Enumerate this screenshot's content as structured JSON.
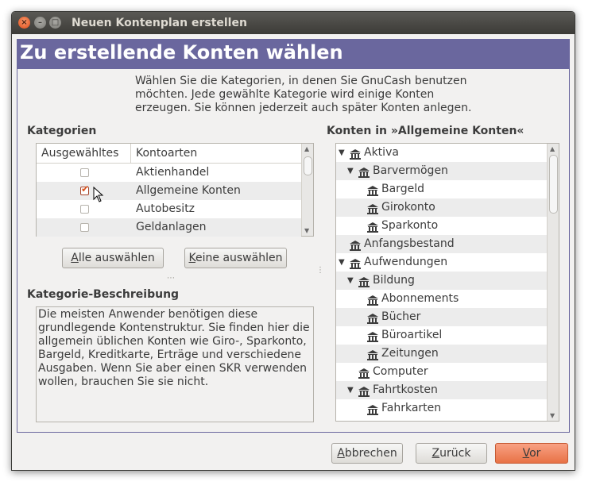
{
  "window": {
    "title": "Neuen Kontenplan erstellen"
  },
  "banner": {
    "title": "Zu erstellende Konten wählen"
  },
  "intro": {
    "lines": [
      "Wählen Sie die Kategorien, in denen Sie GnuCash benutzen",
      "möchten. Jede gewählte Kategorie wird einige Konten",
      "erzeugen. Sie können jederzeit auch später Konten anlegen."
    ]
  },
  "categories": {
    "heading": "Kategorien",
    "columns": {
      "selected": "Ausgewähltes",
      "type": "Kontoarten"
    },
    "rows": [
      {
        "name": "Aktienhandel",
        "checked": false
      },
      {
        "name": "Allgemeine Konten",
        "checked": true
      },
      {
        "name": "Autobesitz",
        "checked": false
      },
      {
        "name": "Geldanlagen",
        "checked": false
      }
    ]
  },
  "buttons": {
    "select_all": {
      "mnemonic": "A",
      "rest": "lle auswählen"
    },
    "select_none": {
      "mnemonic": "K",
      "rest": "eine auswählen"
    },
    "cancel": {
      "mnemonic": "A",
      "rest": "bbrechen"
    },
    "back": {
      "mnemonic": "Z",
      "rest": "urück"
    },
    "forward": {
      "mnemonic": "V",
      "rest": "or"
    }
  },
  "description": {
    "heading": "Kategorie-Beschreibung",
    "lines": [
      "Die meisten Anwender benötigen diese",
      "grundlegende Kontenstruktur. Sie finden hier die",
      "allgemein üblichen Konten wie Giro-, Sparkonto,",
      "Bargeld, Kreditkarte, Erträge und verschiedene",
      "Ausgaben. Wenn Sie aber einen SKR verwenden",
      "wollen, brauchen Sie sie nicht."
    ]
  },
  "accounts": {
    "heading": "Konten in »Allgemeine Konten«",
    "tree": [
      {
        "label": "Aktiva",
        "depth": 0,
        "expanded": true
      },
      {
        "label": "Barvermögen",
        "depth": 1,
        "expanded": true
      },
      {
        "label": "Bargeld",
        "depth": 2,
        "expanded": null
      },
      {
        "label": "Girokonto",
        "depth": 2,
        "expanded": null
      },
      {
        "label": "Sparkonto",
        "depth": 2,
        "expanded": null
      },
      {
        "label": "Anfangsbestand",
        "depth": 0,
        "expanded": null
      },
      {
        "label": "Aufwendungen",
        "depth": 0,
        "expanded": true
      },
      {
        "label": "Bildung",
        "depth": 1,
        "expanded": true
      },
      {
        "label": "Abonnements",
        "depth": 2,
        "expanded": null
      },
      {
        "label": "Bücher",
        "depth": 2,
        "expanded": null
      },
      {
        "label": "Büroartikel",
        "depth": 2,
        "expanded": null
      },
      {
        "label": "Zeitungen",
        "depth": 2,
        "expanded": null
      },
      {
        "label": "Computer",
        "depth": 1,
        "expanded": null
      },
      {
        "label": "Fahrtkosten",
        "depth": 1,
        "expanded": true
      },
      {
        "label": "Fahrkarten",
        "depth": 2,
        "expanded": null
      }
    ]
  },
  "icons": {
    "account": "bank-icon",
    "expander": "triangle-down-icon"
  },
  "colors": {
    "banner": "#6a679e",
    "accent": "#e87246",
    "titlebar": "#3c3b37"
  }
}
